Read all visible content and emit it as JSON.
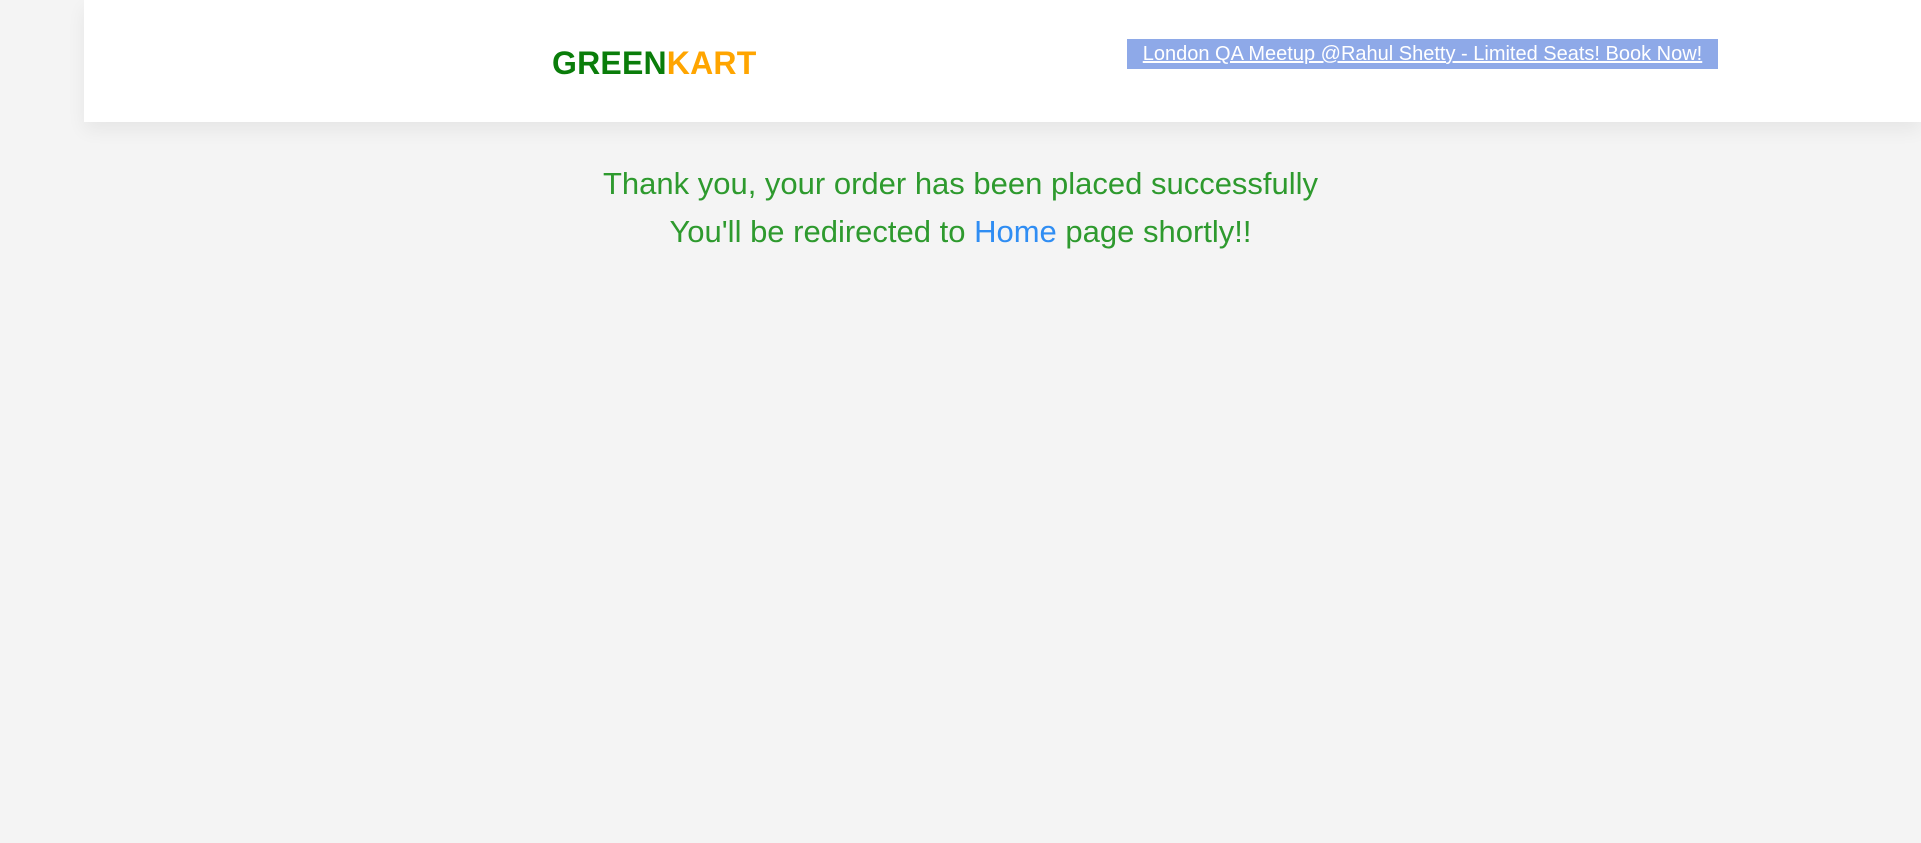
{
  "header": {
    "brand": {
      "part1": "GREEN",
      "part2": "KART"
    },
    "promo_link": "London QA Meetup @Rahul Shetty - Limited Seats! Book Now!"
  },
  "message": {
    "line1": "Thank you, your order has been placed successfully",
    "line2_prefix": "You'll be redirected to ",
    "home_link": "Home",
    "line2_suffix": " page shortly!!"
  },
  "colors": {
    "background": "#f4f4f4",
    "brand_green": "#0a7d0a",
    "brand_orange": "#ffa500",
    "promo_bg": "#8ea9e8",
    "message_green": "#2e9a2e",
    "link_blue": "#2f8df3"
  }
}
